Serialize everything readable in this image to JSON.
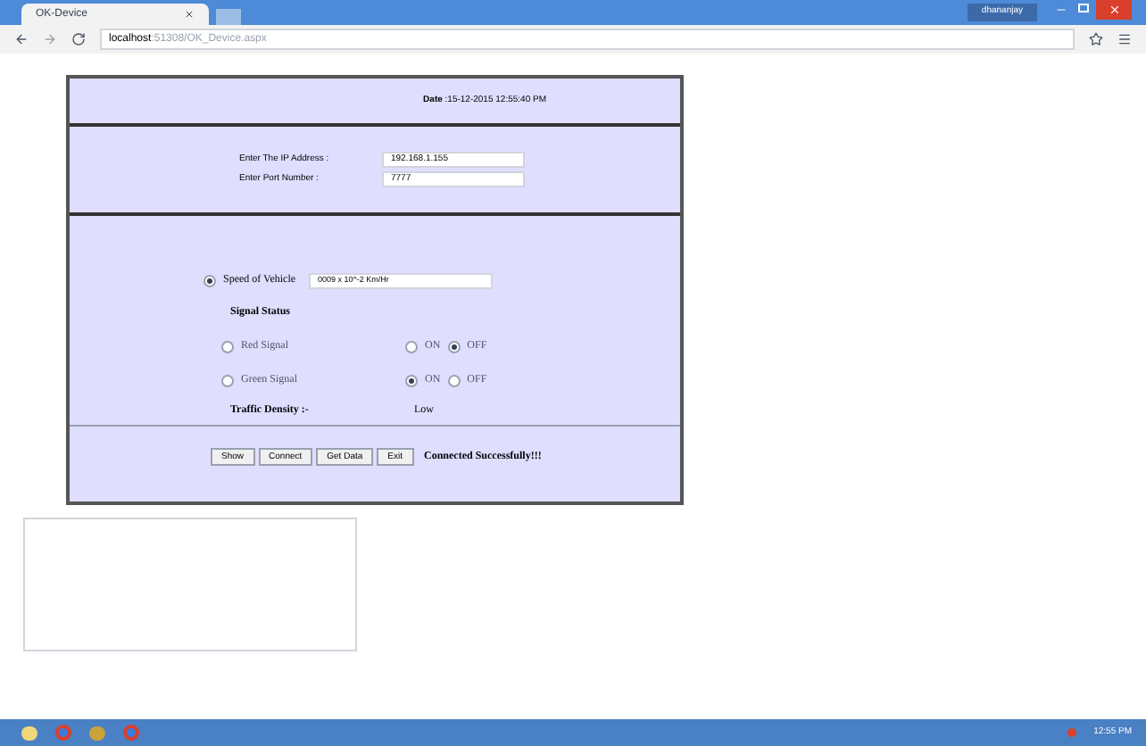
{
  "browser": {
    "tab_title": "OK-Device",
    "user": "dhananjay",
    "url_host": "localhost",
    "url_path": ":51308/OK_Device.aspx"
  },
  "page": {
    "date_label": "Date",
    "date_value": ":15-12-2015 12:55:40 PM",
    "ip": {
      "label": "Enter The IP Address :",
      "value": "192.168.1.155"
    },
    "port": {
      "label": "Enter Port Number :",
      "value": "7777"
    },
    "speed": {
      "label": "Speed of Vehicle",
      "selected": true,
      "value": "0009 x 10^-2  Km/Hr"
    },
    "signal_status": "Signal Status",
    "signals": [
      {
        "label": "Red Signal",
        "selected": false,
        "options": [
          {
            "label": "ON",
            "selected": false
          },
          {
            "label": "OFF",
            "selected": true
          }
        ]
      },
      {
        "label": "Green Signal",
        "selected": false,
        "options": [
          {
            "label": "ON",
            "selected": true
          },
          {
            "label": "OFF",
            "selected": false
          }
        ]
      }
    ],
    "density": {
      "label": "Traffic Density :-",
      "value": "Low"
    },
    "buttons": [
      "Show",
      "Connect",
      "Get Data",
      "Exit"
    ],
    "status": "Connected Successfully!!!"
  },
  "taskbar": {
    "time": "12:55 PM"
  }
}
